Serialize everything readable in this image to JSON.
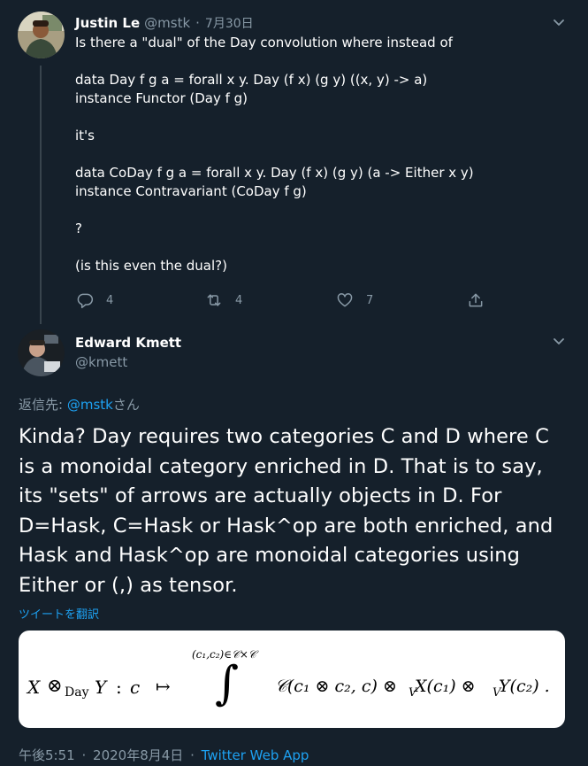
{
  "tweet1": {
    "author": "Justin Le",
    "handle": "@mstk",
    "separator": "·",
    "date": "7月30日",
    "lines": [
      "Is there a \"dual\" of the Day convolution where instead of",
      "",
      "data Day f g a = forall x y. Day (f x) (g y) ((x, y) -> a)",
      "instance Functor (Day f g)",
      "",
      "it's",
      "",
      "data CoDay f g a = forall x y. Day (f x) (g y) (a -> Either x y)",
      "instance Contravariant (CoDay f g)",
      "",
      "?",
      "",
      "(is this even the dual?)"
    ],
    "replies": "4",
    "retweets": "4",
    "likes": "7"
  },
  "tweet2": {
    "author": "Edward Kmett",
    "handle": "@kmett",
    "reply_prefix": "返信先: ",
    "reply_handle": "@mstk",
    "reply_suffix": "さん",
    "text": "Kinda? Day requires two categories C and D where C is a monoidal category enriched in D. That is to say, its \"sets\" of arrows are actually objects in D. For D=Hask, C=Hask or Hask^op are both enriched, and Hask and Hask^op are monoidal categories using Either or (,) as tensor.",
    "translate": "ツイートを翻訳",
    "time": "午後5:51",
    "separator": "·",
    "date": "2020年8月4日",
    "sep2": "·",
    "client": "Twitter Web App"
  },
  "formula": {
    "lhs_X": "X",
    "otimes": "⊗",
    "day_sub": "Day",
    "lhs_Y": "Y",
    "colon": ":",
    "c": "c",
    "mapsto": "↦",
    "integral": "∫",
    "int_sup": "(c₁,c₂)∈𝒞×𝒞",
    "rhs": "𝒞(c₁ ⊗ c₂, c) ⊗",
    "v1": "V",
    "rhs2": " X(c₁) ⊗",
    "v2": "V",
    "rhs3": " Y(c₂) ."
  },
  "colors": {
    "background": "#15202b",
    "link": "#1da1f2",
    "muted": "#8899a6",
    "thread_line": "#38444d"
  }
}
